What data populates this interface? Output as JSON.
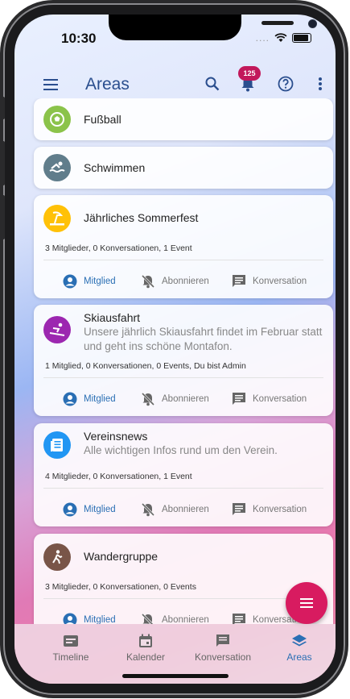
{
  "status_bar": {
    "time": "10:30",
    "dots": "...."
  },
  "app_bar": {
    "title": "Areas",
    "notification_count": "125"
  },
  "areas": [
    {
      "name": "Fußball",
      "icon": "soccer-ball-icon",
      "color": "#8bc34a"
    },
    {
      "name": "Schwimmen",
      "icon": "swimming-icon",
      "color": "#607d8b"
    },
    {
      "name": "Jährliches Sommerfest",
      "icon": "beach-icon",
      "color": "#ffc107",
      "stats": "3 Mitglieder, 0 Konversationen, 1 Event"
    },
    {
      "name": "Skiausfahrt",
      "icon": "skiing-icon",
      "color": "#9c27b0",
      "description": "Unsere jährlich Skiausfahrt findet im Februar statt und geht ins schöne Montafon.",
      "stats": "1 Mitglied, 0 Konversationen, 0 Events, Du bist Admin"
    },
    {
      "name": "Vereinsnews",
      "icon": "newspaper-icon",
      "color": "#2196f3",
      "description": "Alle wichtigen Infos rund um den Verein.",
      "stats": "4 Mitglieder, 0 Konversationen, 1 Event"
    },
    {
      "name": "Wandergruppe",
      "icon": "hiking-icon",
      "color": "#795548",
      "stats": "3 Mitglieder, 0 Konversationen, 0 Events"
    }
  ],
  "actions": {
    "member": "Mitglied",
    "subscribe": "Abonnieren",
    "conversation": "Konversation"
  },
  "bottom_nav": [
    {
      "label": "Timeline",
      "icon": "timeline-icon"
    },
    {
      "label": "Kalender",
      "icon": "calendar-icon"
    },
    {
      "label": "Konversation",
      "icon": "chat-icon"
    },
    {
      "label": "Areas",
      "icon": "layers-icon",
      "active": true
    }
  ],
  "colors": {
    "primary": "#2a4e8e",
    "accent": "#d81b60",
    "active_nav": "#2a6fb4"
  }
}
